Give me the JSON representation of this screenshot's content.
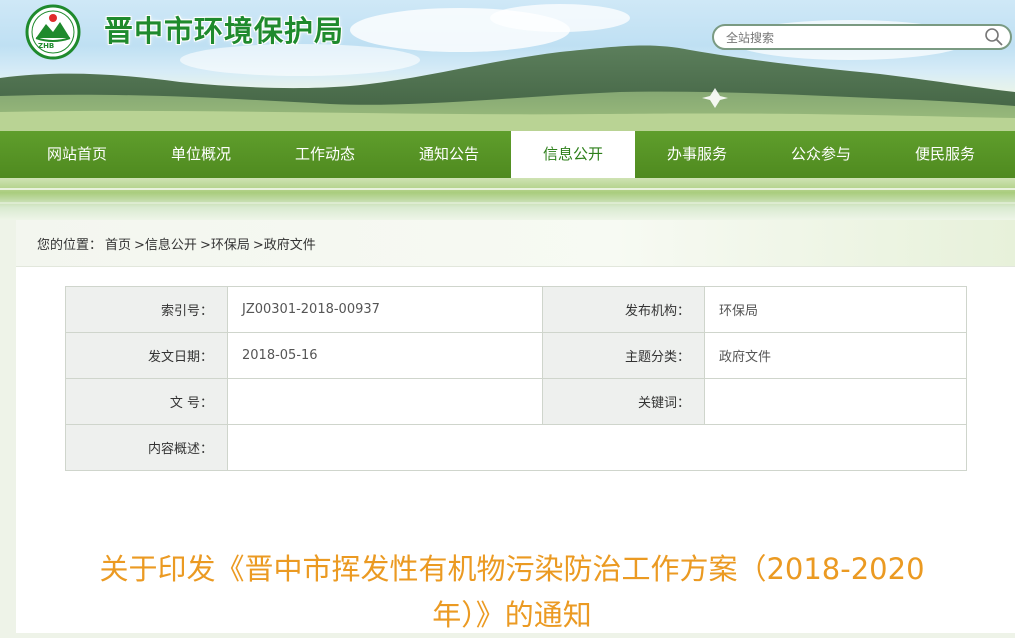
{
  "site": {
    "title": "晋中市环境保护局",
    "logo_text": "ZHB",
    "search_placeholder": "全站搜索"
  },
  "nav": {
    "items": [
      {
        "label": "网站首页"
      },
      {
        "label": "单位概况"
      },
      {
        "label": "工作动态"
      },
      {
        "label": "通知公告"
      },
      {
        "label": "信息公开"
      },
      {
        "label": "办事服务"
      },
      {
        "label": "公众参与"
      },
      {
        "label": "便民服务"
      }
    ],
    "active_index": 4
  },
  "breadcrumb": {
    "prefix": "您的位置：",
    "items": [
      "首页",
      ">信息公开",
      ">环保局",
      ">政府文件"
    ]
  },
  "meta": {
    "index_label": "索引号：",
    "index_value": "JZ00301-2018-00937",
    "publisher_label": "发布机构：",
    "publisher_value": "环保局",
    "date_label": "发文日期：",
    "date_value": "2018-05-16",
    "category_label": "主题分类：",
    "category_value": "政府文件",
    "docno_label": "文 号：",
    "docno_value": "",
    "keywords_label": "关键词：",
    "keywords_value": "",
    "summary_label": "内容概述：",
    "summary_value": ""
  },
  "document": {
    "title": "关于印发《晋中市挥发性有机物污染防治工作方案（2018-2020年）》的通知"
  },
  "colors": {
    "nav_green": "#5f9e2c",
    "title_green": "#1f8a2d",
    "doc_title_orange": "#eb9a22"
  }
}
